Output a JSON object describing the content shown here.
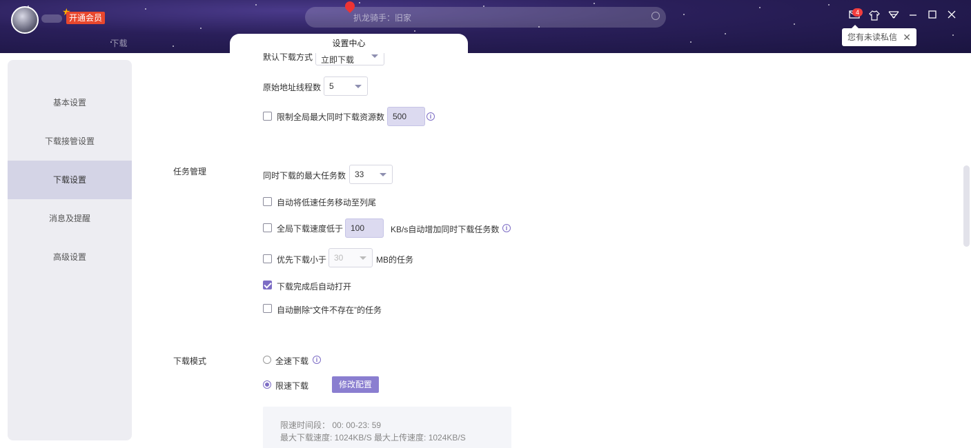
{
  "header": {
    "vip_label": "开通会员",
    "search_placeholder": "扒龙骑手：旧家",
    "message_count": "4",
    "tooltip": "您有未读私信",
    "tooltip_close": "✕",
    "window_controls": {
      "skin": "skin-icon",
      "menu": "menu-icon",
      "minimize": "—",
      "maximize": "☐",
      "close": "✕"
    }
  },
  "tabs": [
    {
      "label": "下载",
      "active": false
    },
    {
      "label": "设置中心",
      "active": true
    }
  ],
  "sidebar": {
    "items": [
      {
        "label": "基本设置",
        "active": false
      },
      {
        "label": "下载接管设置",
        "active": false
      },
      {
        "label": "下载设置",
        "active": true
      },
      {
        "label": "消息及提醒",
        "active": false
      },
      {
        "label": "高级设置",
        "active": false
      }
    ]
  },
  "download": {
    "default_mode_label": "默认下载方式",
    "default_mode_value": "立即下载",
    "origin_threads_label": "原始地址线程数",
    "origin_threads_value": "5",
    "limit_global_label": "限制全局最大同时下载资源数",
    "limit_global_value": "500",
    "limit_global_checked": false
  },
  "task_management": {
    "title": "任务管理",
    "max_tasks_label": "同时下载的最大任务数",
    "max_tasks_value": "33",
    "move_slow_label": "自动将低速任务移动至列尾",
    "move_slow_checked": false,
    "speed_low_prefix": "全局下载速度低于",
    "speed_low_value": "100",
    "speed_low_suffix": "KB/s自动增加同时下载任务数",
    "speed_low_checked": false,
    "priority_prefix": "优先下载小于",
    "priority_value": "30",
    "priority_suffix": "MB的任务",
    "priority_checked": false,
    "auto_open_label": "下载完成后自动打开",
    "auto_open_checked": true,
    "auto_delete_label": "自动删除“文件不存在”的任务",
    "auto_delete_checked": false
  },
  "download_mode": {
    "title": "下载模式",
    "full_speed_label": "全速下载",
    "full_speed_selected": false,
    "limited_label": "限速下载",
    "limited_selected": true,
    "modify_button": "修改配置",
    "period_line": "限速时间段： 00: 00-23: 59",
    "speed_line": "最大下载速度: 1024KB/S   最大上传速度: 1024KB/S"
  },
  "colors": {
    "accent": "#7d6dc5",
    "badge_red": "#f23d3d",
    "vip_red": "#e9472d",
    "sidebar_bg": "#ededf2",
    "sidebar_active": "#d4d4e6"
  }
}
